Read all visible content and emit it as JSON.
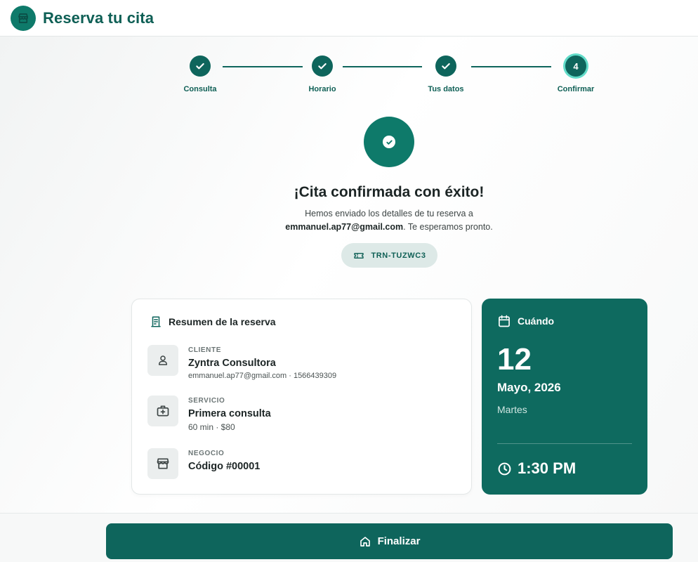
{
  "app": {
    "title": "Reserva tu cita"
  },
  "stepper": {
    "steps": [
      {
        "label": "Consulta",
        "state": "done"
      },
      {
        "label": "Horario",
        "state": "done"
      },
      {
        "label": "Tus datos",
        "state": "done"
      },
      {
        "label": "Confirmar",
        "state": "current",
        "number": "4"
      }
    ]
  },
  "confirmation": {
    "title": "¡Cita confirmada con éxito!",
    "message_before": "Hemos enviado los detalles de tu reserva a",
    "email": "emmanuel.ap77@gmail.com",
    "message_after": ". Te esperamos pronto.",
    "reference": "TRN-TUZWC3"
  },
  "summary": {
    "title": "Resumen de la reserva",
    "client": {
      "caption": "CLIENTE",
      "name": "Zyntra Consultora",
      "detail": "emmanuel.ap77@gmail.com · 1566439309"
    },
    "service": {
      "caption": "SERVICIO",
      "name": "Primera consulta",
      "detail": "60 min · $80"
    },
    "business": {
      "caption": "NEGOCIO",
      "name": "Código #00001"
    }
  },
  "when": {
    "title": "Cuándo",
    "day": "12",
    "month_year": "Mayo, 2026",
    "weekday": "Martes",
    "time": "1:30 PM"
  },
  "footer": {
    "finish_label": "Finalizar"
  },
  "colors": {
    "primary": "#0e655c",
    "accent": "#0e7a6a",
    "current_ring": "#62dcc9",
    "badge_bg": "#dde9e7"
  }
}
